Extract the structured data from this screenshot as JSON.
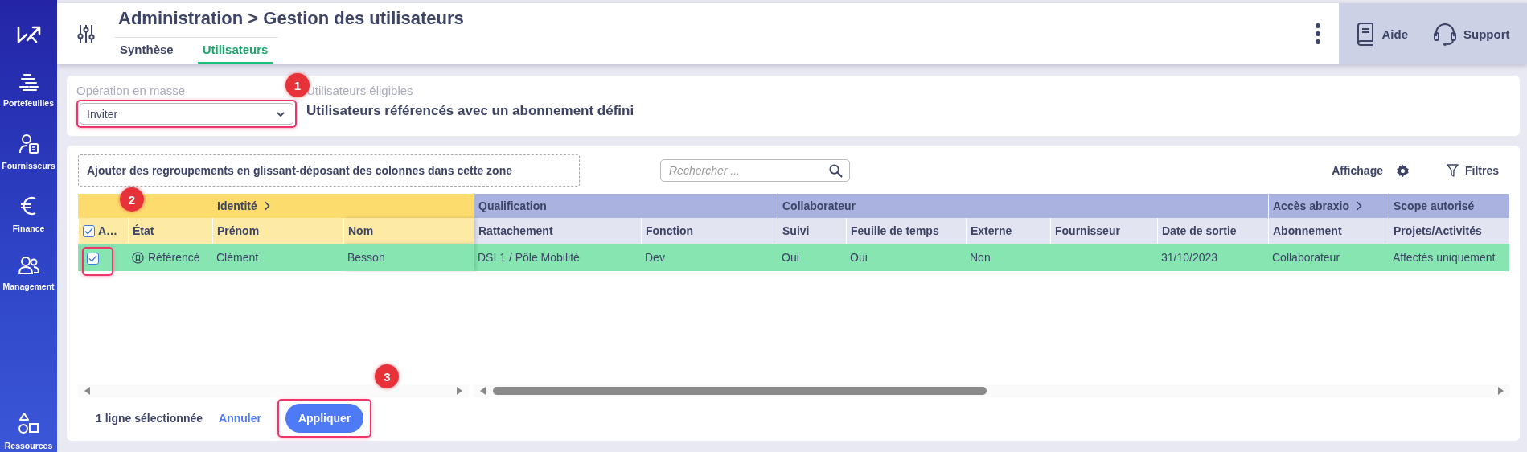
{
  "sidebar": {
    "items": [
      {
        "label": "Portefeuilles"
      },
      {
        "label": "Fournisseurs"
      },
      {
        "label": "Finance"
      },
      {
        "label": "Management"
      },
      {
        "label": "Ressources"
      }
    ]
  },
  "header": {
    "breadcrumb": "Administration > Gestion des utilisateurs",
    "tabs": [
      {
        "label": "Synthèse",
        "selected": false
      },
      {
        "label": "Utilisateurs",
        "selected": true
      }
    ],
    "help": "Aide",
    "support": "Support"
  },
  "bulk": {
    "label": "Opération en masse",
    "value": "Inviter",
    "callout": "1",
    "eligible_label": "Utilisateurs éligibles",
    "eligible_value": "Utilisateurs référencés avec un abonnement défini"
  },
  "grid": {
    "group_zone": "Ajouter des regroupements en glissant-déposant des colonnes dans cette zone",
    "search": {
      "placeholder": "Rechercher ..."
    },
    "display": "Affichage",
    "filters": "Filtres",
    "all_selected": true,
    "column_groups": [
      {
        "frozen": true,
        "expandable": false,
        "columns": [
          {
            "label": "A…",
            "kind": "select"
          },
          {
            "label": "État",
            "kind": "status"
          }
        ]
      },
      {
        "label": "Identité",
        "frozen": true,
        "expandable": true,
        "columns": [
          {
            "label": "Prénom",
            "kind": "text"
          },
          {
            "label": "Nom",
            "kind": "text"
          }
        ]
      },
      {
        "label": "Qualification",
        "frozen": false,
        "expandable": false,
        "columns": [
          {
            "label": "Rattachement",
            "kind": "text"
          },
          {
            "label": "Fonction",
            "kind": "text"
          }
        ]
      },
      {
        "label": "Collaborateur",
        "frozen": false,
        "expandable": false,
        "columns": [
          {
            "label": "Suivi",
            "kind": "text"
          },
          {
            "label": "Feuille de temps",
            "kind": "text"
          },
          {
            "label": "Externe",
            "kind": "text"
          },
          {
            "label": "Fournisseur",
            "kind": "text"
          },
          {
            "label": "Date de sortie",
            "kind": "text"
          }
        ]
      },
      {
        "label": "Accès abraxio",
        "frozen": false,
        "expandable": true,
        "columns": [
          {
            "label": "Abonnement",
            "kind": "text"
          }
        ]
      },
      {
        "label": "Scope autorisé",
        "frozen": false,
        "expandable": false,
        "columns": [
          {
            "label": "Projets/Activités",
            "kind": "text"
          }
        ]
      }
    ],
    "rows": [
      {
        "selected": true,
        "callout": "2",
        "status": "Référencé",
        "cells": [
          "Clément",
          "Besson",
          "DSI 1 / Pôle Mobilité",
          "Dev",
          "Oui",
          "Oui",
          "Non",
          null,
          "31/10/2023",
          "Collaborateur",
          "Affectés uniquement"
        ]
      }
    ]
  },
  "footer": {
    "selection": "1 ligne sélectionnée",
    "cancel": "Annuler",
    "apply": "Appliquer",
    "callout": "3"
  }
}
